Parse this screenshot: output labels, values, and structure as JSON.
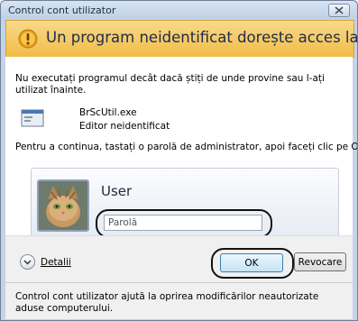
{
  "window": {
    "title": "Control cont utilizator"
  },
  "banner": {
    "text": "Un program neidentificat dorește acces la computer",
    "icon": "shield-warning-icon"
  },
  "content": {
    "warning": "Nu executați programul decât dacă știți de unde provine sau l-ați utilizat înainte.",
    "program_name": "BrScUtil.exe",
    "program_publisher": "Editor neidentificat",
    "instruction": "Pentru a continua, tastați o parolă de administrator, apoi faceți clic pe OK."
  },
  "credentials": {
    "username": "User",
    "password_placeholder": "Parolă"
  },
  "buttons": {
    "details": "Detalii",
    "ok": "OK",
    "cancel": "Revocare"
  },
  "footer": {
    "text": "Control cont utilizator ajută la oprirea modificărilor neautorizate aduse computerului."
  },
  "colors": {
    "banner": "#f1bc47",
    "titlebar": "#c3d4e8"
  }
}
